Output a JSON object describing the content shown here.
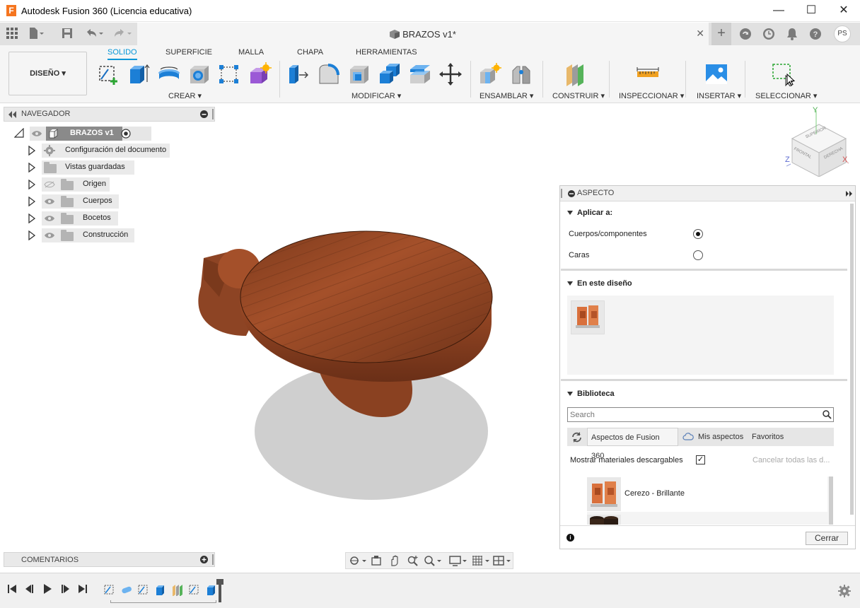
{
  "window": {
    "title": "Autodesk Fusion 360 (Licencia educativa)",
    "logo_letter": "F",
    "minimize_glyph": "—",
    "maximize_glyph": "☐",
    "close_glyph": "✕"
  },
  "tabbar": {
    "document_title": "BRAZOS v1*",
    "close_glyph": "✕",
    "new_tab_glyph": "+",
    "user_initials": "PS"
  },
  "toolbar": {
    "workspace_label": "DISEÑO ▾",
    "ribbon_tabs": [
      "SOLIDO",
      "SUPERFICIE",
      "MALLA",
      "CHAPA",
      "HERRAMIENTAS"
    ],
    "groups": [
      "CREAR ▾",
      "MODIFICAR ▾",
      "ENSAMBLAR ▾",
      "CONSTRUIR ▾",
      "INSPECCIONAR ▾",
      "INSERTAR ▾",
      "SELECCIONAR ▾"
    ]
  },
  "navigator": {
    "title": "NAVEGADOR",
    "root": "BRAZOS v1",
    "items": [
      {
        "label": "Configuración del documento",
        "icon": "gear-icon"
      },
      {
        "label": "Vistas guardadas",
        "icon": "folder-icon"
      },
      {
        "label": "Origen",
        "icon": "folder-icon"
      },
      {
        "label": "Cuerpos",
        "icon": "folder-icon"
      },
      {
        "label": "Bocetos",
        "icon": "folder-icon"
      },
      {
        "label": "Construcción",
        "icon": "folder-icon"
      }
    ]
  },
  "viewcube": {
    "top": "SUPERIOR",
    "front": "FRONTAL",
    "right": "DERECHA",
    "axis_x": "X",
    "axis_y": "Y",
    "axis_z": "Z"
  },
  "aspect": {
    "title": "ASPECTO",
    "apply_to_title": "Aplicar a:",
    "option_bodies": "Cuerpos/componentes",
    "option_faces": "Caras",
    "selected_option": "Cuerpos/componentes",
    "in_design_title": "En este diseño",
    "library_title": "Biblioteca",
    "search_placeholder": "Search",
    "library_tabs": [
      "Aspectos de Fusion 360",
      "Mis aspectos",
      "Favoritos"
    ],
    "show_downloadable_label": "Mostrar materiales descargables",
    "show_downloadable_checked": true,
    "check_glyph": "✓",
    "cancel_all_label": "Cancelar todas las d...",
    "library_items": [
      "Cerezo - Brillante"
    ],
    "close_button": "Cerrar",
    "info_glyph": "i"
  },
  "comments": {
    "title": "COMENTARIOS"
  },
  "colors": {
    "accent": "#0696d7",
    "wood": "#a4502a",
    "brand": "#f5751f"
  }
}
